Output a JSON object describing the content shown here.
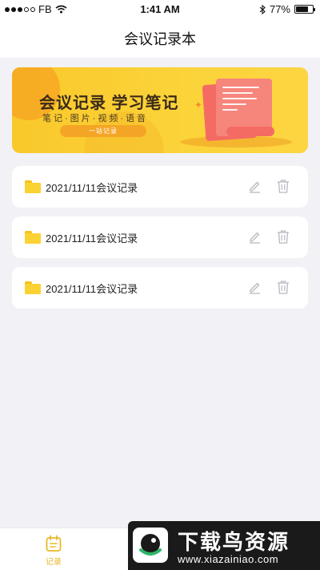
{
  "status": {
    "carrier": "FB",
    "time": "1:41 AM",
    "battery": "77%",
    "battery_level": 0.77
  },
  "header": {
    "title": "会议记录本"
  },
  "banner": {
    "title": "会议记录 学习笔记",
    "subtitle": "笔记·图片·视频·语音",
    "pill": "一站记录"
  },
  "records": [
    {
      "title": "2021/11/11会议记录",
      "edit_icon": "pencil-icon",
      "delete_icon": "trash-icon"
    },
    {
      "title": "2021/11/11会议记录",
      "edit_icon": "pencil-icon",
      "delete_icon": "trash-icon"
    },
    {
      "title": "2021/11/11会议记录",
      "edit_icon": "pencil-icon",
      "delete_icon": "trash-icon"
    }
  ],
  "tabbar": {
    "items": [
      {
        "label": "记录",
        "icon": "calendar-icon",
        "active": true
      }
    ]
  },
  "watermark": {
    "title": "下载鸟资源",
    "url": "www.xiazainiao.com"
  },
  "colors": {
    "accent": "#f6c21a",
    "tab_active": "#e8b92c",
    "background": "#f1f1f6"
  }
}
